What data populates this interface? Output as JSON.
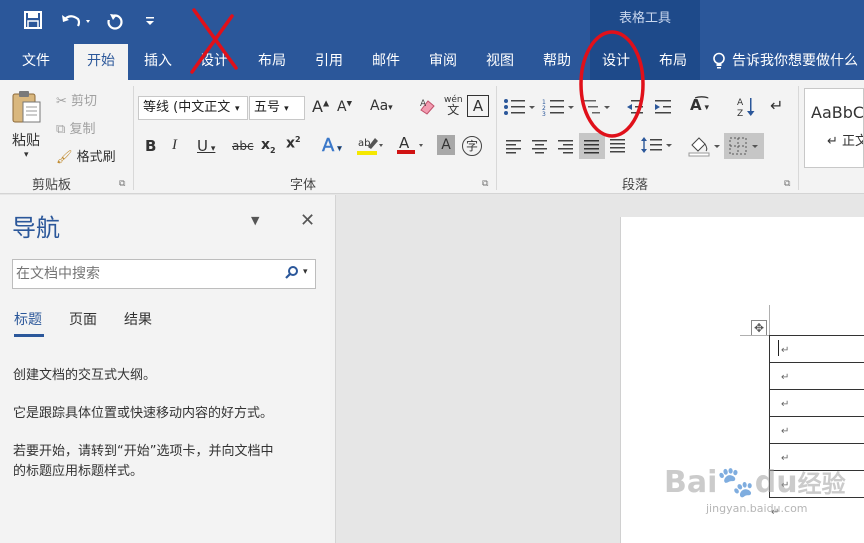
{
  "ribbon_tabs": [
    {
      "label": "文件"
    },
    {
      "label": "开始"
    },
    {
      "label": "插入"
    },
    {
      "label": "设计"
    },
    {
      "label": "布局"
    },
    {
      "label": "引用"
    },
    {
      "label": "邮件"
    },
    {
      "label": "审阅"
    },
    {
      "label": "视图"
    },
    {
      "label": "帮助"
    },
    {
      "label": "设计"
    },
    {
      "label": "布局"
    }
  ],
  "context_tools_label": "表格工具",
  "tell_me": "告诉我你想要做什么",
  "clipboard": {
    "paste": "粘贴",
    "cut": "剪切",
    "copy": "复制",
    "format_painter": "格式刷",
    "group": "剪贴板"
  },
  "font": {
    "font_name": "等线 (中文正文",
    "font_size": "五号",
    "aa_change_case": "Aa",
    "group": "字体"
  },
  "paragraph": {
    "group": "段落"
  },
  "styles": {
    "preview": "AaBbC",
    "name": "↵ 正文"
  },
  "nav": {
    "title": "导航",
    "search_placeholder": "在文档中搜索",
    "tabs": [
      "标题",
      "页面",
      "结果"
    ],
    "line1": "创建文档的交互式大纲。",
    "line2": "它是跟踪具体位置或快速移动内容的好方式。",
    "line3a": "若要开始，请转到“开始”选项卡，并向文档中",
    "line3b": "的标题应用标题样式。"
  },
  "watermark": {
    "brand": "Bai",
    "brand2": "du",
    "jingyan": "经验",
    "url": "jingyan.baidu.com"
  },
  "colors": {
    "ribbon_blue": "#2b579a",
    "annotation_red": "#e0101a"
  }
}
